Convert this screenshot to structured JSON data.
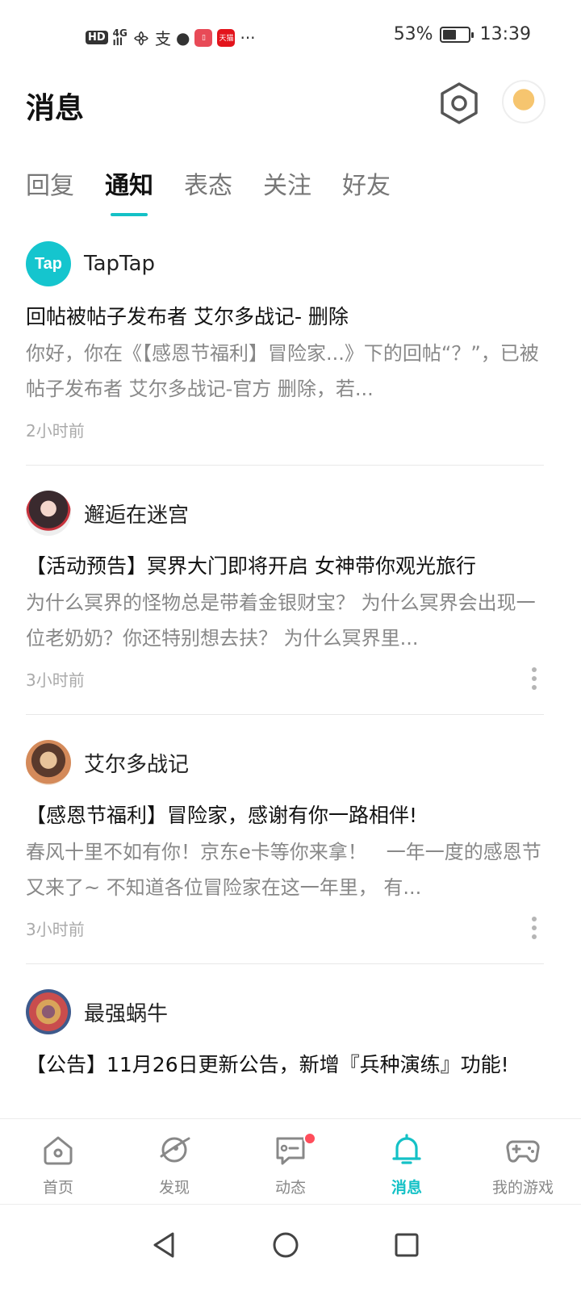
{
  "status_bar": {
    "left": {
      "hd": "HD",
      "network_top": "4G",
      "network_bottom": "⁴ᵍ",
      "app_badge_red": "天猫"
    },
    "battery_text": "53%",
    "battery_level": 0.53,
    "time": "13:39"
  },
  "header": {
    "title": "消息"
  },
  "tabs": [
    {
      "label": "回复",
      "active": false
    },
    {
      "label": "通知",
      "active": true
    },
    {
      "label": "表态",
      "active": false
    },
    {
      "label": "关注",
      "active": false
    },
    {
      "label": "好友",
      "active": false
    }
  ],
  "notifications": [
    {
      "author": "TapTap",
      "avatar_text": "Tap",
      "title": "回帖被帖子发布者 艾尔多战记- 删除",
      "body": "你好，你在《【感恩节福利】冒险家...》下的回帖“？”，已被帖子发布者 艾尔多战记-官方 删除，若...",
      "time": "2小时前",
      "has_more": false
    },
    {
      "author": "邂逅在迷宫",
      "title": "【活动预告】冥界大门即将开启 女神带你观光旅行",
      "body": "为什么冥界的怪物总是带着金银财宝？ 为什么冥界会出现一位老奶奶？你还特别想去扶？ 为什么冥界里...",
      "time": "3小时前",
      "has_more": true
    },
    {
      "author": "艾尔多战记",
      "title": "【感恩节福利】冒险家，感谢有你一路相伴!",
      "body": "春风十里不如有你！京东e卡等你来拿！　一年一度的感恩节又来了~ 不知道各位冒险家在这一年里， 有...",
      "time": "3小时前",
      "has_more": true
    },
    {
      "author": "最强蜗牛",
      "title": "【公告】11月26日更新公告，新增『兵种演练』功能!",
      "body": "",
      "time": "",
      "has_more": false
    }
  ],
  "bottom_nav": [
    {
      "label": "首页",
      "icon": "home-icon",
      "active": false
    },
    {
      "label": "发现",
      "icon": "discover-icon",
      "active": false
    },
    {
      "label": "动态",
      "icon": "feed-icon",
      "active": false,
      "badge": true
    },
    {
      "label": "消息",
      "icon": "bell-icon",
      "active": true
    },
    {
      "label": "我的游戏",
      "icon": "gamepad-icon",
      "active": false
    }
  ],
  "colors": {
    "accent": "#14c1c6",
    "badge": "#ff4d5b",
    "taptap": "#15c5ce"
  }
}
